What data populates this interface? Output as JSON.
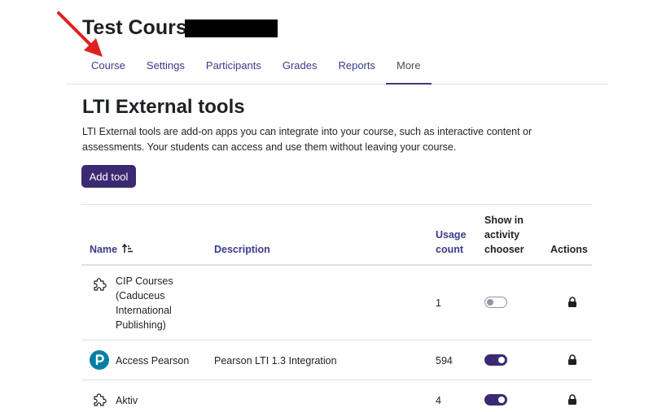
{
  "course": {
    "title": "Test Course"
  },
  "tabs": [
    {
      "label": "Course"
    },
    {
      "label": "Settings"
    },
    {
      "label": "Participants"
    },
    {
      "label": "Grades"
    },
    {
      "label": "Reports"
    },
    {
      "label": "More",
      "active": true
    }
  ],
  "page": {
    "heading": "LTI External tools",
    "description": "LTI External tools are add-on apps you can integrate into your course, such as interactive content or assessments. Your students can access and use them without leaving your course.",
    "add_button": "Add tool"
  },
  "table": {
    "headers": {
      "name": "Name",
      "description": "Description",
      "usage_line1": "Usage",
      "usage_line2": "count",
      "show_line1": "Show in",
      "show_line2": "activity",
      "show_line3": "chooser",
      "actions": "Actions"
    },
    "rows": [
      {
        "name_lines": [
          "CIP Courses",
          "(Caduceus",
          "International",
          "Publishing)"
        ],
        "description": "",
        "usage": "1",
        "show_in_chooser": false,
        "icon": "puzzle-icon"
      },
      {
        "name_lines": [
          "Access Pearson"
        ],
        "description": "Pearson LTI 1.3 Integration",
        "usage": "594",
        "show_in_chooser": true,
        "icon": "pearson-logo-icon"
      },
      {
        "name_lines": [
          "Aktiv"
        ],
        "description": "",
        "usage": "4",
        "show_in_chooser": true,
        "icon": "puzzle-icon"
      }
    ]
  },
  "colors": {
    "primary": "#3b2a72",
    "link": "#3a3a8c",
    "arrow": "#e02020",
    "pearson": "#007fa3"
  }
}
